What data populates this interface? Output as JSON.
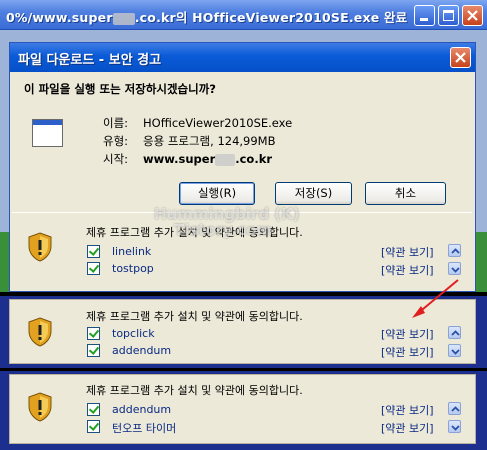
{
  "background_window": {
    "title_prefix": "0%/www.super",
    "title_suffix": ".co.kr의 HOfficeViewer2010SE.exe 완료"
  },
  "dialog": {
    "title": "파일 다운로드 - 보안 경고",
    "question": "이 파일을 실행 또는 저장하시겠습니까?",
    "name_label": "이름:",
    "name_value": "HOfficeViewer2010SE.exe",
    "type_label": "유형:",
    "type_value": "응용 프로그램, 124,99MB",
    "from_label": "시작:",
    "from_value_prefix": "www.super",
    "from_value_suffix": ".co.kr",
    "run_label": "실행(R)",
    "save_label": "저장(S)",
    "cancel_label": "취소"
  },
  "watermark": {
    "line1": "Hummingbird (K)",
    "line2": "Tistory.com"
  },
  "panels": [
    {
      "heading": "제휴 프로그램 추가 설치 및 약관에 동의합니다.",
      "items": [
        "linelink",
        "tostpop"
      ],
      "terms": [
        "[약관 보기]",
        "[약관 보기]"
      ]
    },
    {
      "heading": "제휴 프로그램 추가 설치 및 약관에 동의합니다.",
      "items": [
        "topclick",
        "addendum"
      ],
      "terms": [
        "[약관 보기]",
        "[약관 보기]"
      ]
    },
    {
      "heading": "제휴 프로그램 추가 설치 및 약관에 동의합니다.",
      "items": [
        "addendum",
        "턴오프 타이머"
      ],
      "terms": [
        "[약관 보기]",
        "[약관 보기]"
      ]
    }
  ],
  "colors": {
    "titlebar": "#0a5bd8",
    "dialog_bg": "#ece9d8",
    "link": "#0a2a84",
    "arrow": "#e02020"
  }
}
